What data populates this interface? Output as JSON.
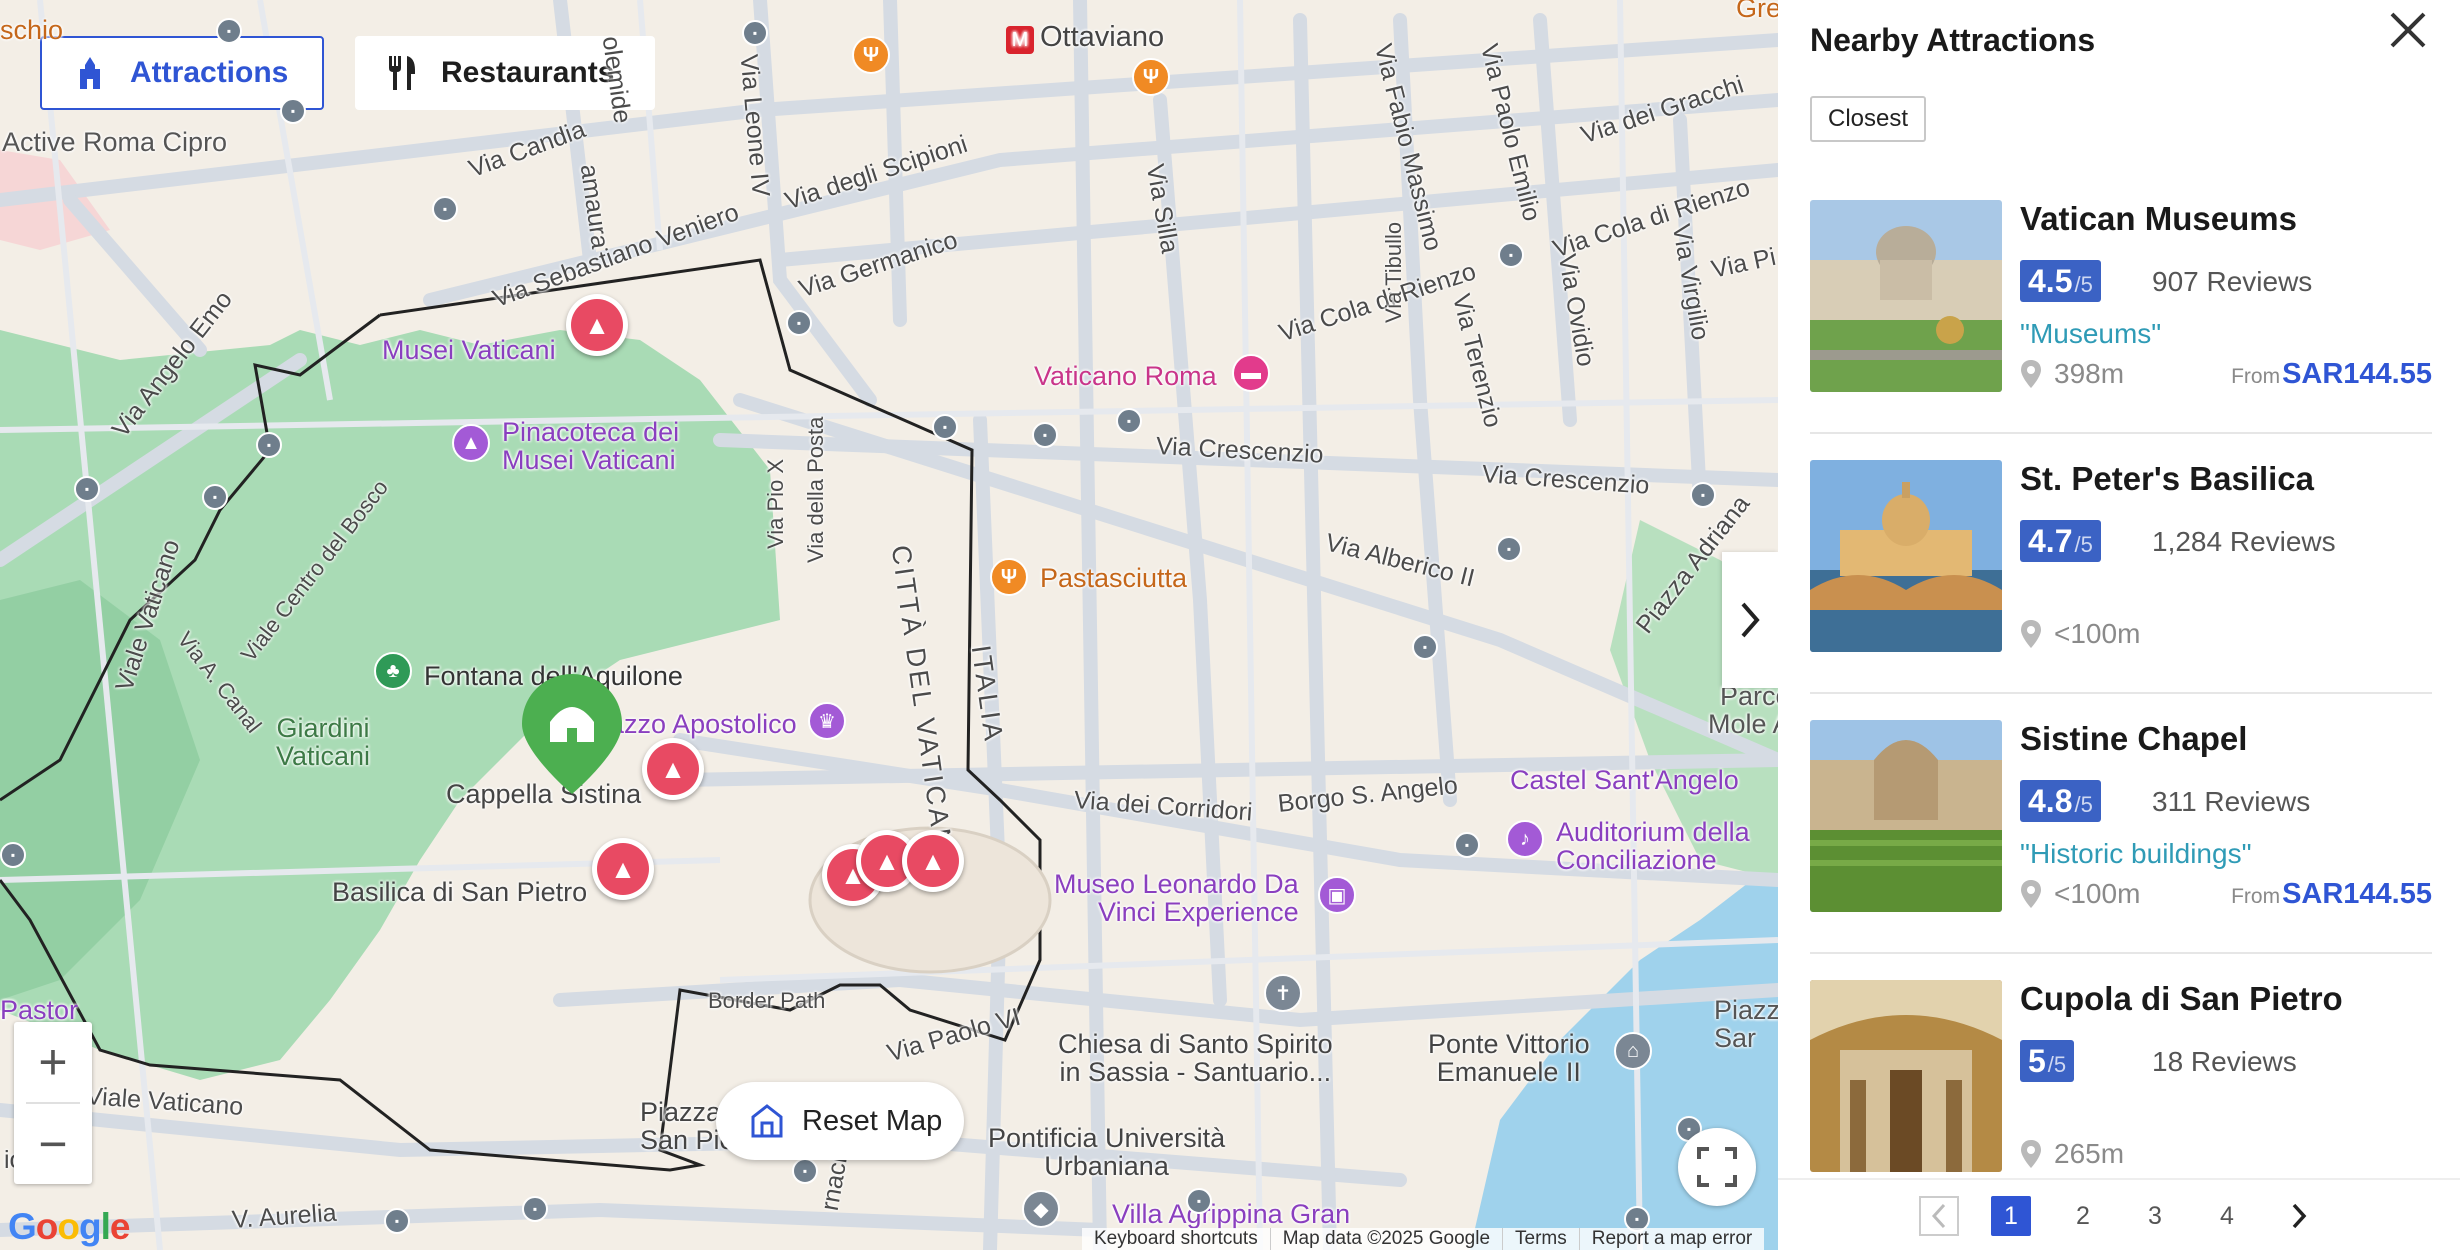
{
  "map": {
    "tabs": [
      {
        "label": "Attractions",
        "icon": "attraction-icon",
        "active": true
      },
      {
        "label": "Restaurants",
        "icon": "fork-knife-icon",
        "active": false
      }
    ],
    "labels": {
      "ottaviano": "Ottaviano",
      "active_roma": "Active Roma Cipro",
      "musei_vaticani": "Musei Vaticani",
      "pinacoteca_1": "Pinacoteca dei",
      "pinacoteca_2": "Musei Vaticani",
      "vaticano_roma": "Vaticano Roma",
      "pastasciutta": "Pastasciutta",
      "fontana": "Fontana dell'Aquilone",
      "giardini_1": "Giardini",
      "giardini_2": "Vaticani",
      "palazzo": "Palazzo Apostolico",
      "cappella": "Cappella Sistina",
      "basilica": "Basilica di San Pietro",
      "castel": "Castel Sant'Angelo",
      "auditorium_1": "Auditorium della",
      "auditorium_2": "Conciliazione",
      "museo_1": "Museo Leonardo Da",
      "museo_2": "Vinci Experience",
      "chiesa_1": "Chiesa di Santo Spirito",
      "chiesa_2": "in Sassia - Santuario...",
      "ponte_1": "Ponte Vittorio",
      "ponte_2": "Emanuele II",
      "pontificia_1": "Pontificia Università",
      "pontificia_2": "Urbaniana",
      "villa": "Villa Agrippina Gran",
      "parco_1": "Parco",
      "parco_2": "Mole A",
      "pastor": "Pastor",
      "piazza_sp_1": "Piazza",
      "piazza_sp_2": "San Pie",
      "piazza_r1": "Piazz",
      "piazza_r2": "Sar",
      "schio": "schio",
      "gre": "Gre"
    },
    "streets": {
      "via_candia": "Via Candia",
      "via_scipioni": "Via degli Scipioni",
      "via_veniero": "Via Sebastiano Veniero",
      "via_germanico": "Via Germanico",
      "via_leone": "Via Leone IV",
      "via_angelo_emo": "Via Angelo Emo",
      "viale_vaticano": "Viale Vaticano",
      "viale_vaticano_2": "Viale Vaticano",
      "via_crescenzio": "Via Crescenzio",
      "via_crescenzio_2": "Via Crescenzio",
      "via_cola": "Via Cola di Rienzo",
      "via_cola_2": "Via Cola di Rienzo",
      "via_alberico": "Via Alberico II",
      "via_corridori": "Via dei Corridori",
      "borgo": "Borgo S. Angelo",
      "via_paolo": "Via Paolo VI",
      "border_path": "Border Path",
      "citta": "CITTÀ DEL VATICANO",
      "italia": "ITALIA",
      "viale_bosco": "Viale Centro del Bosco",
      "via_canal": "Via A. Canal",
      "via_pio": "Via Pio X",
      "via_posta": "Via della Posta",
      "via_silla": "Via Silla",
      "via_fabio": "Via Fabio Massimo",
      "via_tibullo": "Via Tibullo",
      "via_terenzio": "Via Terenzio",
      "via_emilio": "Via Paolo Emilio",
      "via_ovidio": "Via Ovidio",
      "via_virgilio": "Via Virgilio",
      "via_gracchi": "Via dei Gracchi",
      "piazza_adriana": "Piazza Adriana",
      "via_aurelia": "V. Aurelia",
      "via_pi": "Via Pi",
      "via_amaura": "amaura",
      "via_ole": "olemide",
      "via_cipro_o": "io",
      "via_tracia": "rnaci"
    },
    "reset_label": "Reset Map",
    "attribution": [
      "Keyboard shortcuts",
      "Map data ©2025 Google",
      "Terms",
      "Report a map error"
    ],
    "google": "Google",
    "colors": {
      "accent": "#2f55d4",
      "attraction_pin": "#e84a63",
      "vatican_green": "#9bd4a8",
      "water": "#9fd2ec",
      "map_bg": "#f3eee6"
    }
  },
  "panel": {
    "title": "Nearby Attractions",
    "sort": "Closest",
    "items": [
      {
        "name": "Vatican Museums",
        "score": "4.5",
        "max": "/5",
        "reviews": "907 Reviews",
        "tag": "\"Museums\"",
        "distance": "398m",
        "from": "From",
        "price": "SAR144.55"
      },
      {
        "name": "St. Peter's Basilica",
        "score": "4.7",
        "max": "/5",
        "reviews": "1,284 Reviews",
        "tag": "",
        "distance": "<100m",
        "from": "",
        "price": ""
      },
      {
        "name": "Sistine Chapel",
        "score": "4.8",
        "max": "/5",
        "reviews": "311 Reviews",
        "tag": "\"Historic buildings\"",
        "distance": "<100m",
        "from": "From",
        "price": "SAR144.55"
      },
      {
        "name": "Cupola di San Pietro",
        "score": "5",
        "max": "/5",
        "reviews": "18 Reviews",
        "tag": "",
        "distance": "265m",
        "from": "",
        "price": ""
      }
    ],
    "pages": [
      "1",
      "2",
      "3",
      "4"
    ],
    "current_page": "1"
  }
}
